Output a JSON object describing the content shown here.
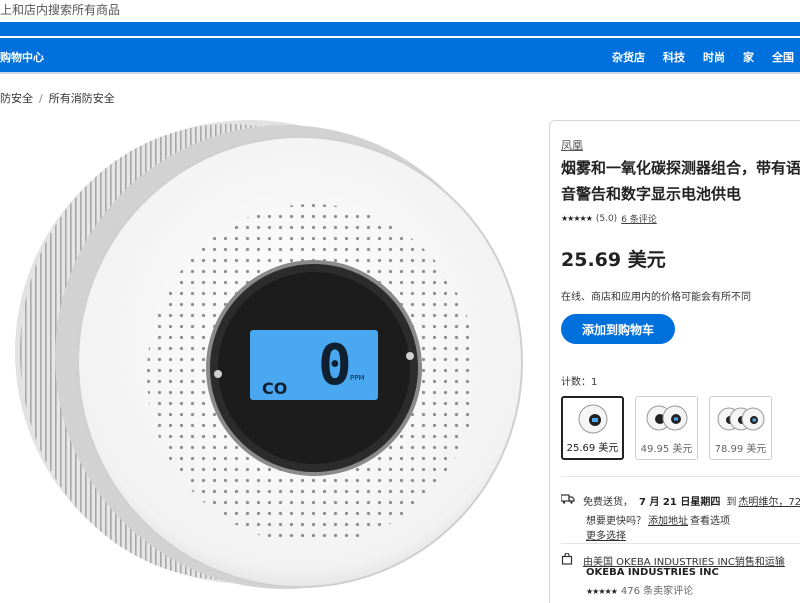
{
  "search": {
    "placeholder_text": "上和店内搜索所有商品"
  },
  "nav": {
    "left_label": "购物中心",
    "links": [
      "杂货店",
      "科技",
      "时尚",
      "家",
      "全国"
    ]
  },
  "breadcrumb": [
    "防安全",
    "所有消防安全"
  ],
  "product": {
    "brand": "凤凰",
    "title": "烟雾和一氧化碳探测器组合，带有语音警告和数字显示电池供电",
    "rating_stars": "★★★★★",
    "rating_value": "(5.0)",
    "reviews_link": "6 条评论",
    "price": "25.69 美元",
    "price_note": "在线、商店和应用内的价格可能会有所不同",
    "add_to_cart": "添加到购物车",
    "count_label": "计数：1",
    "display_reading": "0",
    "display_label_co": "CO",
    "display_unit": "PPM",
    "options": [
      {
        "price": "25.69 美元",
        "selected": true
      },
      {
        "price": "49.95 美元",
        "selected": false
      },
      {
        "price": "78.99 美元",
        "selected": false
      }
    ]
  },
  "shipping": {
    "free_label": "免费送货，",
    "date": "7 月 21 日星期四",
    "to_label": "到",
    "location": "杰明维尔，72",
    "faster_label": "想要更快吗？",
    "add_address": "添加地址",
    "see_options": "查看选项",
    "more_options": "更多选择"
  },
  "seller": {
    "sold_by": "由美国 OKEBA INDUSTRIES INC销售和运输",
    "name": "OKEBA INDUSTRIES INC",
    "rating_stars": "★★★★★",
    "reviews": "476 条卖家评论"
  },
  "colors": {
    "accent": "#0071dc",
    "lcd": "#4aa8f0"
  }
}
